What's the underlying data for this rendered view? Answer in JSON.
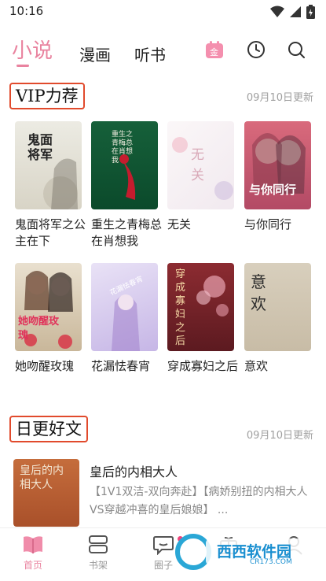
{
  "status_bar": {
    "time": "10:16"
  },
  "top_nav": {
    "tabs": [
      {
        "label": "小说",
        "active": true
      },
      {
        "label": "漫画",
        "active": false
      },
      {
        "label": "听书",
        "active": false
      }
    ],
    "icons": [
      "gold-coin-calendar-icon",
      "history-clock-icon",
      "search-icon"
    ],
    "coin_glyph": "金",
    "accent_color": "#e9839f"
  },
  "vip_section": {
    "title": "VIP力荐",
    "updated": "09月10日更新",
    "books": [
      {
        "title": "鬼面将军之公主在下",
        "cover_text": "鬼面将军"
      },
      {
        "title": "重生之青梅总在肖想我",
        "cover_text": "重生之青梅总在肖想我"
      },
      {
        "title": "无关",
        "cover_text": "无关"
      },
      {
        "title": "与你同行",
        "cover_text": "与你同行"
      },
      {
        "title": "她吻醒玫瑰",
        "cover_text": "她吻醒玫瑰"
      },
      {
        "title": "花漏怯春宵",
        "cover_text": "花漏怯春宵"
      },
      {
        "title": "穿成寡妇之后",
        "cover_text": "穿成寡妇之后"
      },
      {
        "title": "意欢",
        "cover_text": "意欢"
      }
    ]
  },
  "daily_section": {
    "title": "日更好文",
    "updated": "09月10日更新",
    "item": {
      "title": "皇后的内相大人",
      "desc": "【1V1双洁-双向奔赴】【病娇别扭的内相大人VS穿越冲喜的皇后娘娘】 ...",
      "cover_text": "皇后的内相大人"
    }
  },
  "bottom_nav": {
    "items": [
      {
        "label": "首页",
        "active": true,
        "icon": "book-home-icon"
      },
      {
        "label": "书架",
        "active": false,
        "icon": "bookshelf-icon"
      },
      {
        "label": "圈子",
        "active": false,
        "icon": "chat-bubble-icon"
      },
      {
        "label": "",
        "active": false,
        "icon": "gift-icon"
      },
      {
        "label": "",
        "active": false,
        "icon": "profile-icon"
      }
    ]
  },
  "watermark": {
    "brand": "西西软件园",
    "url": "CR173.COM"
  }
}
